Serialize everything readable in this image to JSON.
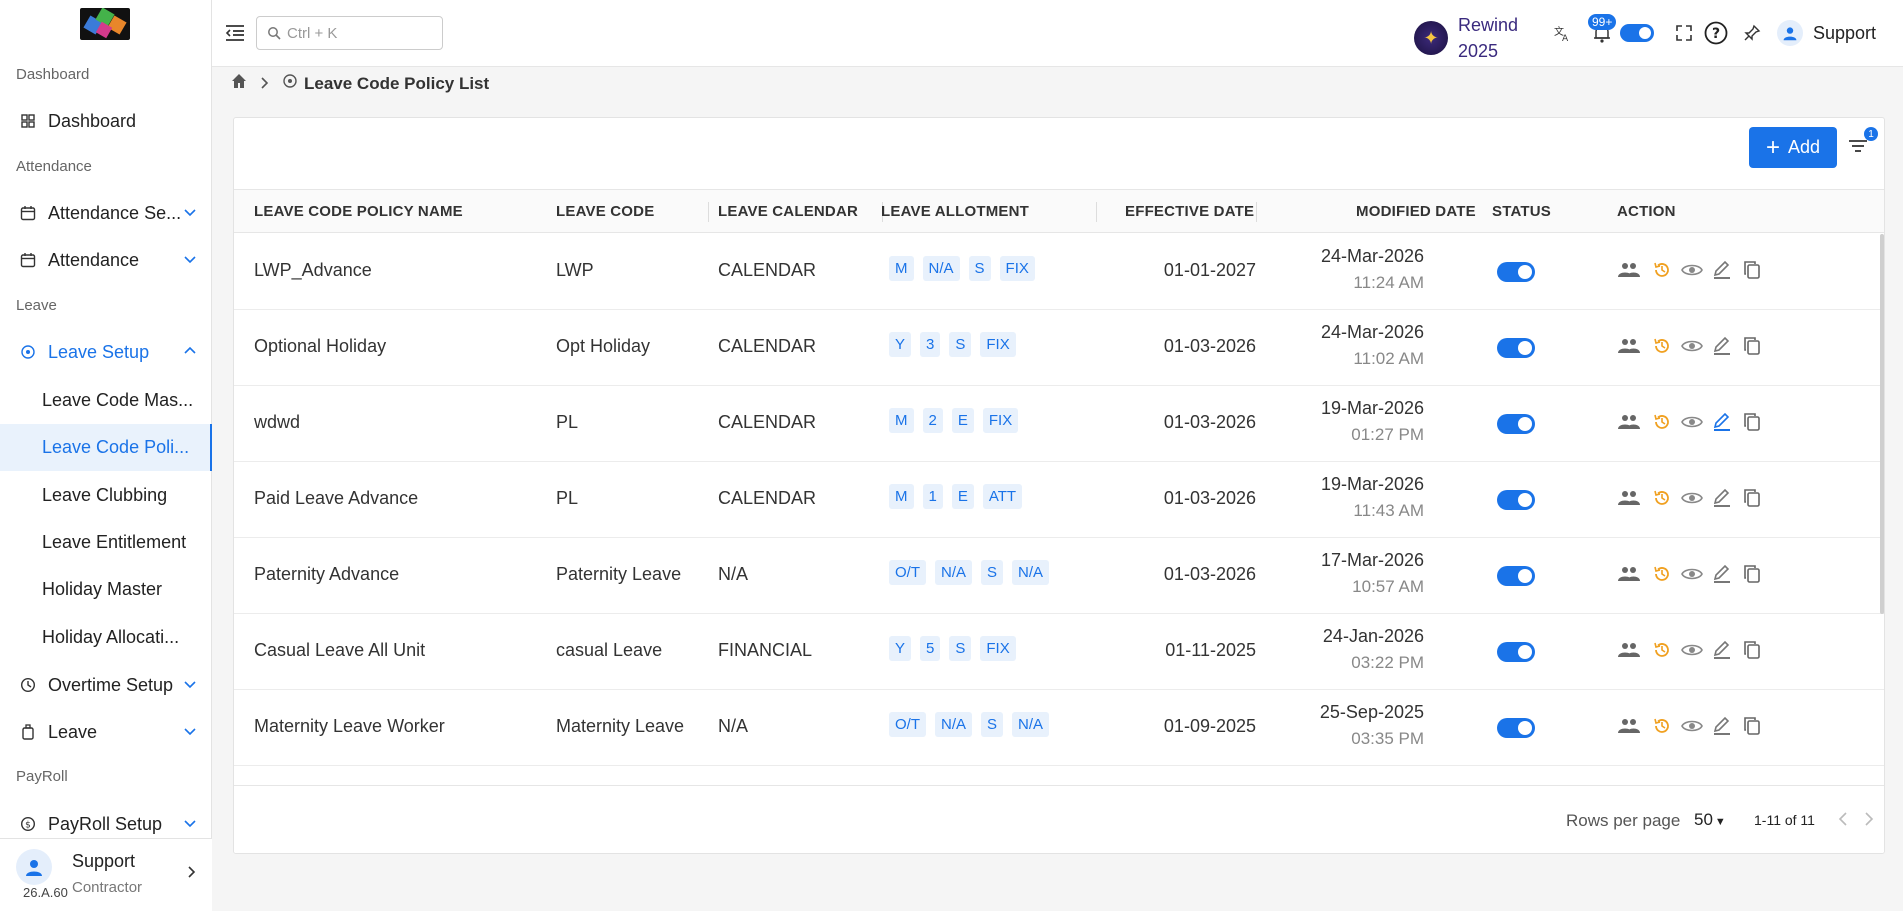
{
  "sidebar": {
    "sections": {
      "dashboard": "Dashboard",
      "attendance": "Attendance",
      "leave": "Leave",
      "payroll": "PayRoll"
    },
    "items": {
      "dashboard": "Dashboard",
      "attendance_setup": "Attendance Se...",
      "attendance": "Attendance",
      "leave_setup": "Leave Setup",
      "overtime_setup": "Overtime Setup",
      "leave": "Leave",
      "payroll_setup": "PayRoll Setup"
    },
    "leave_setup_children": [
      "Leave Code Mas...",
      "Leave Code Poli...",
      "Leave Clubbing",
      "Leave Entitlement",
      "Holiday Master",
      "Holiday Allocati..."
    ],
    "footer": {
      "name": "Support",
      "role": "Contractor",
      "version": "26.A.60"
    }
  },
  "topbar": {
    "search_placeholder": "Ctrl + K",
    "rewind_line1": "Rewind",
    "rewind_line2": "2025",
    "notif_count": "99+",
    "user_name": "Support"
  },
  "breadcrumb": {
    "current": "Leave Code Policy List"
  },
  "toolbar": {
    "add_label": "Add",
    "filter_count": "1"
  },
  "table": {
    "headers": [
      "LEAVE CODE POLICY NAME",
      "LEAVE CODE",
      "LEAVE CALENDAR",
      "LEAVE ALLOTMENT",
      "EFFECTIVE DATE",
      "MODIFIED DATE",
      "STATUS",
      "ACTION"
    ],
    "rows": [
      {
        "name": "LWP_Advance",
        "code": "LWP",
        "calendar": "CALENDAR",
        "allotment": [
          "M",
          "N/A",
          "S",
          "FIX"
        ],
        "effective": "01-01-2027",
        "mod_date": "24-Mar-2026",
        "mod_time": "11:24 AM"
      },
      {
        "name": "Optional Holiday",
        "code": "Opt Holiday",
        "calendar": "CALENDAR",
        "allotment": [
          "Y",
          "3",
          "S",
          "FIX"
        ],
        "effective": "01-03-2026",
        "mod_date": "24-Mar-2026",
        "mod_time": "11:02 AM"
      },
      {
        "name": "wdwd",
        "code": "PL",
        "calendar": "CALENDAR",
        "allotment": [
          "M",
          "2",
          "E",
          "FIX"
        ],
        "effective": "01-03-2026",
        "mod_date": "19-Mar-2026",
        "mod_time": "01:27 PM"
      },
      {
        "name": "Paid Leave Advance",
        "code": "PL",
        "calendar": "CALENDAR",
        "allotment": [
          "M",
          "1",
          "E",
          "ATT"
        ],
        "effective": "01-03-2026",
        "mod_date": "19-Mar-2026",
        "mod_time": "11:43 AM"
      },
      {
        "name": "Paternity Advance",
        "code": "Paternity Leave",
        "calendar": "N/A",
        "allotment": [
          "O/T",
          "N/A",
          "S",
          "N/A"
        ],
        "effective": "01-03-2026",
        "mod_date": "17-Mar-2026",
        "mod_time": "10:57 AM"
      },
      {
        "name": "Casual Leave All Unit",
        "code": "casual Leave",
        "calendar": "FINANCIAL",
        "allotment": [
          "Y",
          "5",
          "S",
          "FIX"
        ],
        "effective": "01-11-2025",
        "mod_date": "24-Jan-2026",
        "mod_time": "03:22 PM"
      },
      {
        "name": "Maternity Leave Worker",
        "code": "Maternity Leave",
        "calendar": "N/A",
        "allotment": [
          "O/T",
          "N/A",
          "S",
          "N/A"
        ],
        "effective": "01-09-2025",
        "mod_date": "25-Sep-2025",
        "mod_time": "03:35 PM"
      }
    ]
  },
  "pagination": {
    "rows_per_page_label": "Rows per page",
    "rows_per_page": "50",
    "info": "1-11 of 11"
  },
  "colors": {
    "accent": "#1a73e8",
    "history_icon": "#f0a020"
  }
}
